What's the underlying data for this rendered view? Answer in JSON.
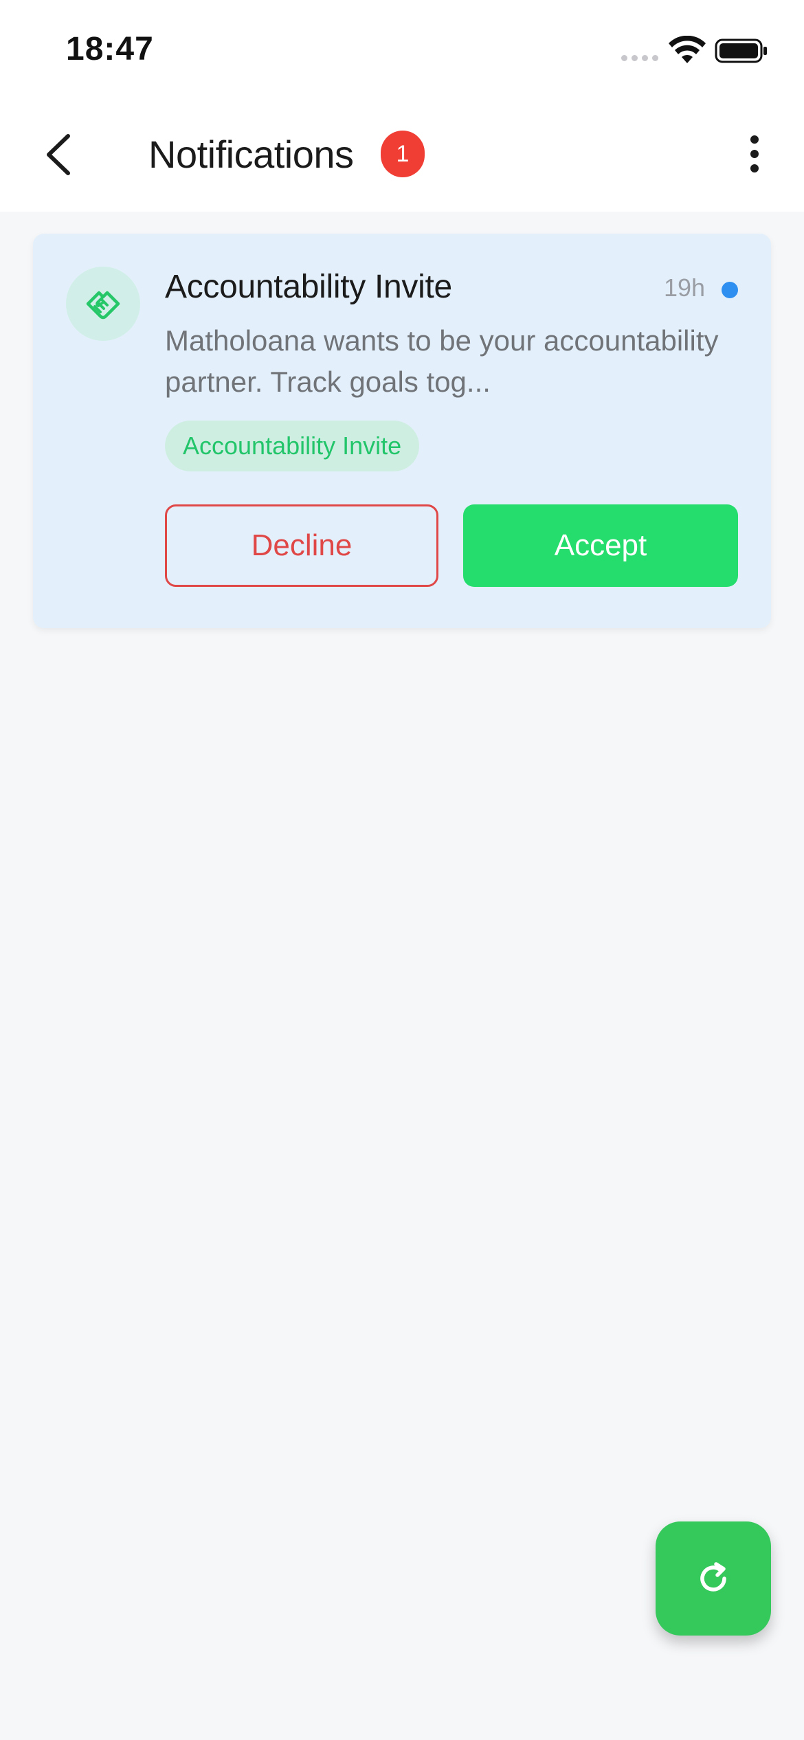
{
  "status_bar": {
    "time": "18:47",
    "icons": [
      "signal-dots-icon",
      "wifi-icon",
      "battery-icon"
    ]
  },
  "header": {
    "title": "Notifications",
    "unread_count": "1",
    "back_icon": "chevron-left-icon",
    "menu_icon": "more-vertical-icon"
  },
  "notifications": [
    {
      "icon": "handshake-icon",
      "title": "Accountability Invite",
      "time": "19h",
      "unread": true,
      "message": "Matholoana wants to be your accountability partner. Track goals tog...",
      "tag": "Accountability Invite",
      "decline_label": "Decline",
      "accept_label": "Accept"
    }
  ],
  "fab": {
    "icon": "refresh-icon"
  },
  "colors": {
    "accent_green": "#25dd6d",
    "decline_red": "#e04848",
    "badge_red": "#f03e35",
    "unread_blue": "#2f8ff0",
    "card_background": "#e3f0fb",
    "fab_green": "#35c95b"
  }
}
